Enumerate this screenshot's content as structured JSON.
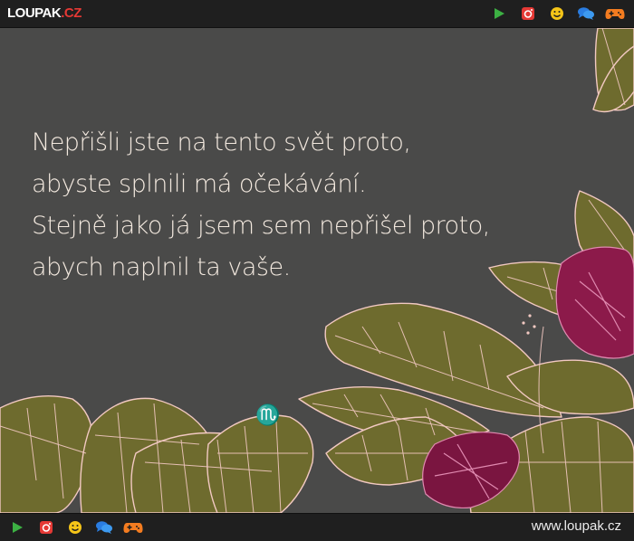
{
  "header": {
    "logo_main": "LOUPAK",
    "logo_tld": ".CZ",
    "icons": [
      "play-icon",
      "instagram-icon",
      "smiley-icon",
      "chat-icon",
      "gamepad-icon"
    ]
  },
  "quote": {
    "lines": [
      "Nepřišli jste na tento svět proto,",
      "abyste splnili má očekávání.",
      "Stejně jako já jsem sem nepřišel proto,",
      "abych naplnil ta vaše."
    ],
    "zodiac_sign": "♏"
  },
  "footer": {
    "site_url": "www.loupak.cz",
    "icons": [
      "play-icon",
      "instagram-icon",
      "smiley-icon",
      "chat-icon",
      "gamepad-icon"
    ]
  },
  "colors": {
    "bars": "#1f1f1f",
    "background": "#4a4a49",
    "text": "#f3e9df",
    "leaf": "#6e6b2e",
    "leaf_line": "#f2c9c2",
    "flower": "#8c1a4a",
    "logo_accent": "#e53935"
  }
}
